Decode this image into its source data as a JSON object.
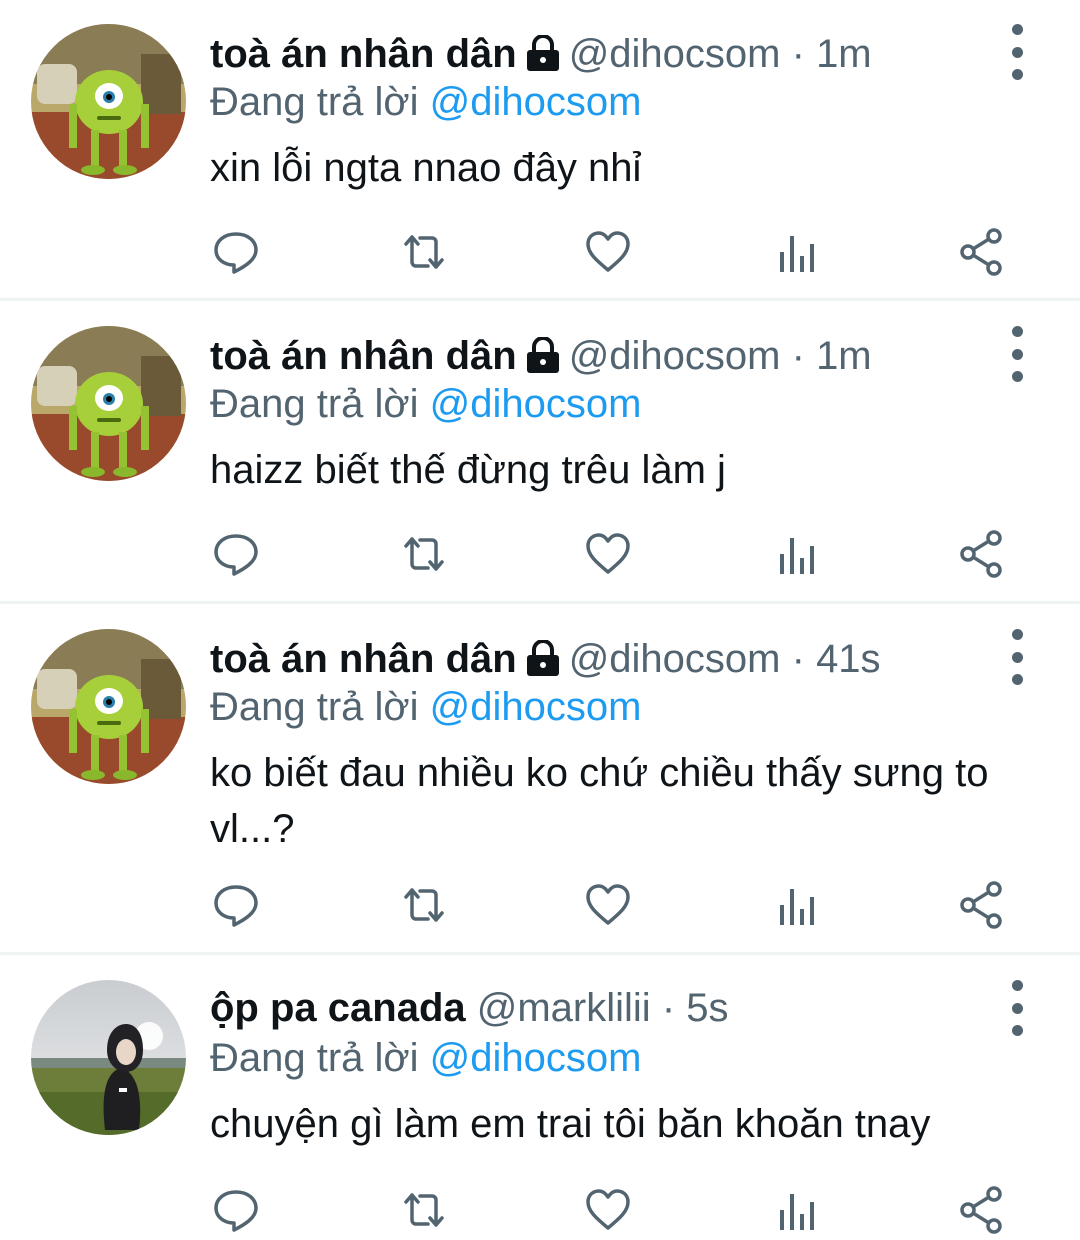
{
  "tweets": [
    {
      "display_name": "toà án nhân dân",
      "handle": "@dihocsom",
      "dot": "·",
      "time": "1m",
      "replying_label": "Đang trả lời",
      "replying_to": "@dihocsom",
      "text": "xin lỗi ngta nnao đây nhỉ",
      "avatar": "green-monster-avatar",
      "locked": true
    },
    {
      "display_name": "toà án nhân dân",
      "handle": "@dihocsom",
      "dot": "·",
      "time": "1m",
      "replying_label": "Đang trả lời",
      "replying_to": "@dihocsom",
      "text": "haizz biết thế đừng trêu làm j",
      "avatar": "green-monster-avatar",
      "locked": true
    },
    {
      "display_name": "toà án nhân dân",
      "handle": "@dihocsom",
      "dot": "·",
      "time": "41s",
      "replying_label": "Đang trả lời",
      "replying_to": "@dihocsom",
      "text": "ko biết đau nhiều ko chứ chiều thấy sưng to vl...?",
      "avatar": "green-monster-avatar",
      "locked": true
    },
    {
      "display_name": "ộp pa canada",
      "handle": "@marklilii",
      "dot": "·",
      "time": "5s",
      "replying_label": "Đang trả lời",
      "replying_to": "@dihocsom",
      "text": "chuyện gì làm em trai tôi băn khoăn tnay",
      "avatar": "person-hoodie-avatar",
      "locked": false
    }
  ],
  "action_icons": [
    "reply-icon",
    "retweet-icon",
    "like-icon",
    "analytics-icon",
    "share-icon"
  ],
  "colors": {
    "text_primary": "#0f1419",
    "text_secondary": "#536471",
    "link": "#1d9bf0",
    "divider": "#eff3f4"
  }
}
